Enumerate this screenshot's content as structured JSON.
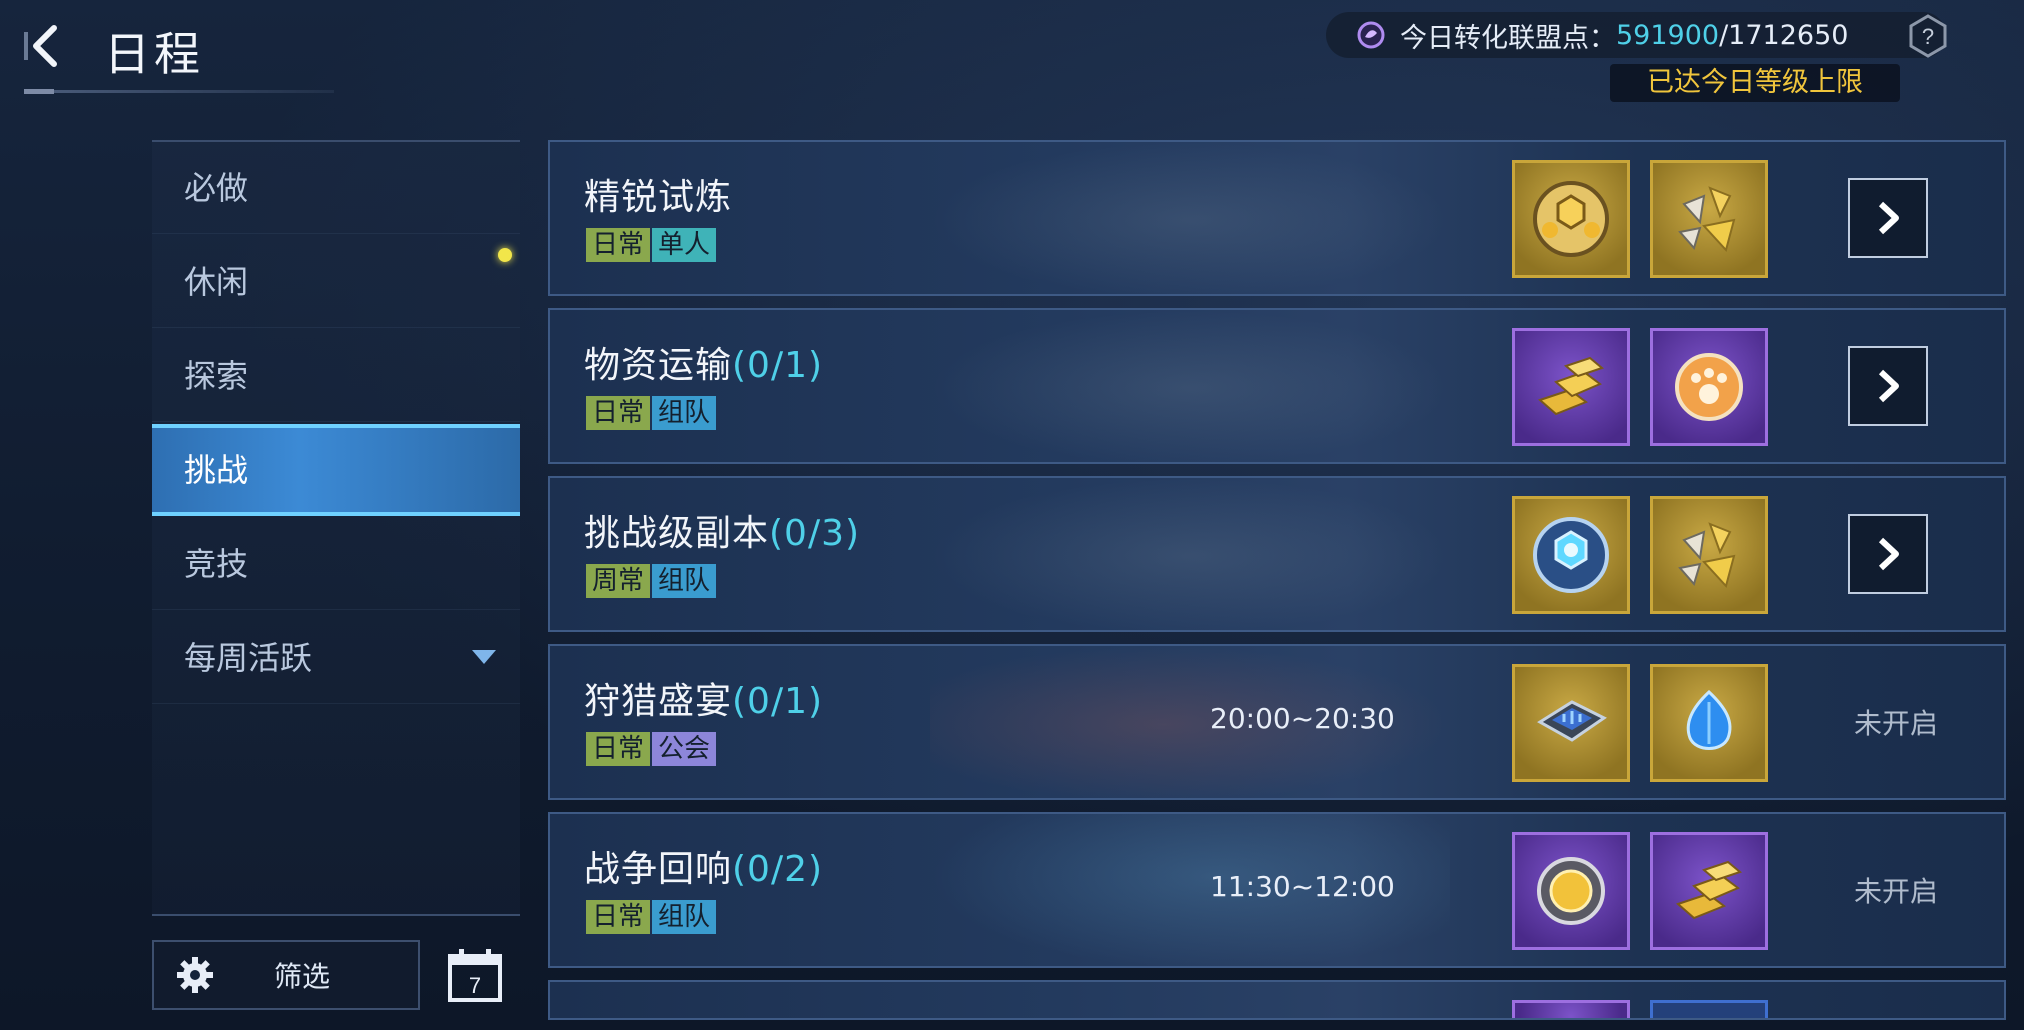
{
  "header": {
    "title": "日程",
    "points_label": "今日转化联盟点：",
    "points_current": "591900",
    "points_sep_total": "/1712650",
    "limit_notice": "已达今日等级上限"
  },
  "sidebar": {
    "items": [
      {
        "label": "必做"
      },
      {
        "label": "休闲"
      },
      {
        "label": "探索"
      },
      {
        "label": "挑战"
      },
      {
        "label": "竞技"
      },
      {
        "label": "每周活跃"
      }
    ],
    "active_index": 3,
    "filter_label": "筛选",
    "calendar_day": "7"
  },
  "activities": [
    {
      "name": "精锐试炼",
      "progress": "",
      "tags": [
        "日常",
        "单人"
      ],
      "time": "",
      "rewards": [
        "gold-sphere",
        "gold-crystals"
      ],
      "reward_frames": [
        "gold",
        "gold"
      ],
      "action": "go"
    },
    {
      "name": "物资运输",
      "progress": "(0/1)",
      "tags": [
        "日常",
        "组队"
      ],
      "time": "",
      "rewards": [
        "gold-bars",
        "paw-badge"
      ],
      "reward_frames": [
        "purple",
        "purple"
      ],
      "action": "go"
    },
    {
      "name": "挑战级副本",
      "progress": "(0/3)",
      "tags": [
        "周常",
        "组队"
      ],
      "time": "",
      "rewards": [
        "blue-sphere",
        "gold-crystals"
      ],
      "reward_frames": [
        "gold",
        "gold"
      ],
      "action": "go"
    },
    {
      "name": "狩猎盛宴",
      "progress": "(0/1)",
      "tags": [
        "日常",
        "公会"
      ],
      "time": "20:00~20:30",
      "rewards": [
        "chip",
        "blue-gem"
      ],
      "reward_frames": [
        "gold",
        "gold"
      ],
      "action": "未开启"
    },
    {
      "name": "战争回响",
      "progress": "(0/2)",
      "tags": [
        "日常",
        "组队"
      ],
      "time": "11:30~12:00",
      "rewards": [
        "gold-coin",
        "gold-bars"
      ],
      "reward_frames": [
        "purple",
        "purple"
      ],
      "action": "未开启"
    }
  ],
  "colors": {
    "accent": "#4fd0e8",
    "notice": "#f0c53c",
    "active_tab": "#3c8ad5"
  }
}
